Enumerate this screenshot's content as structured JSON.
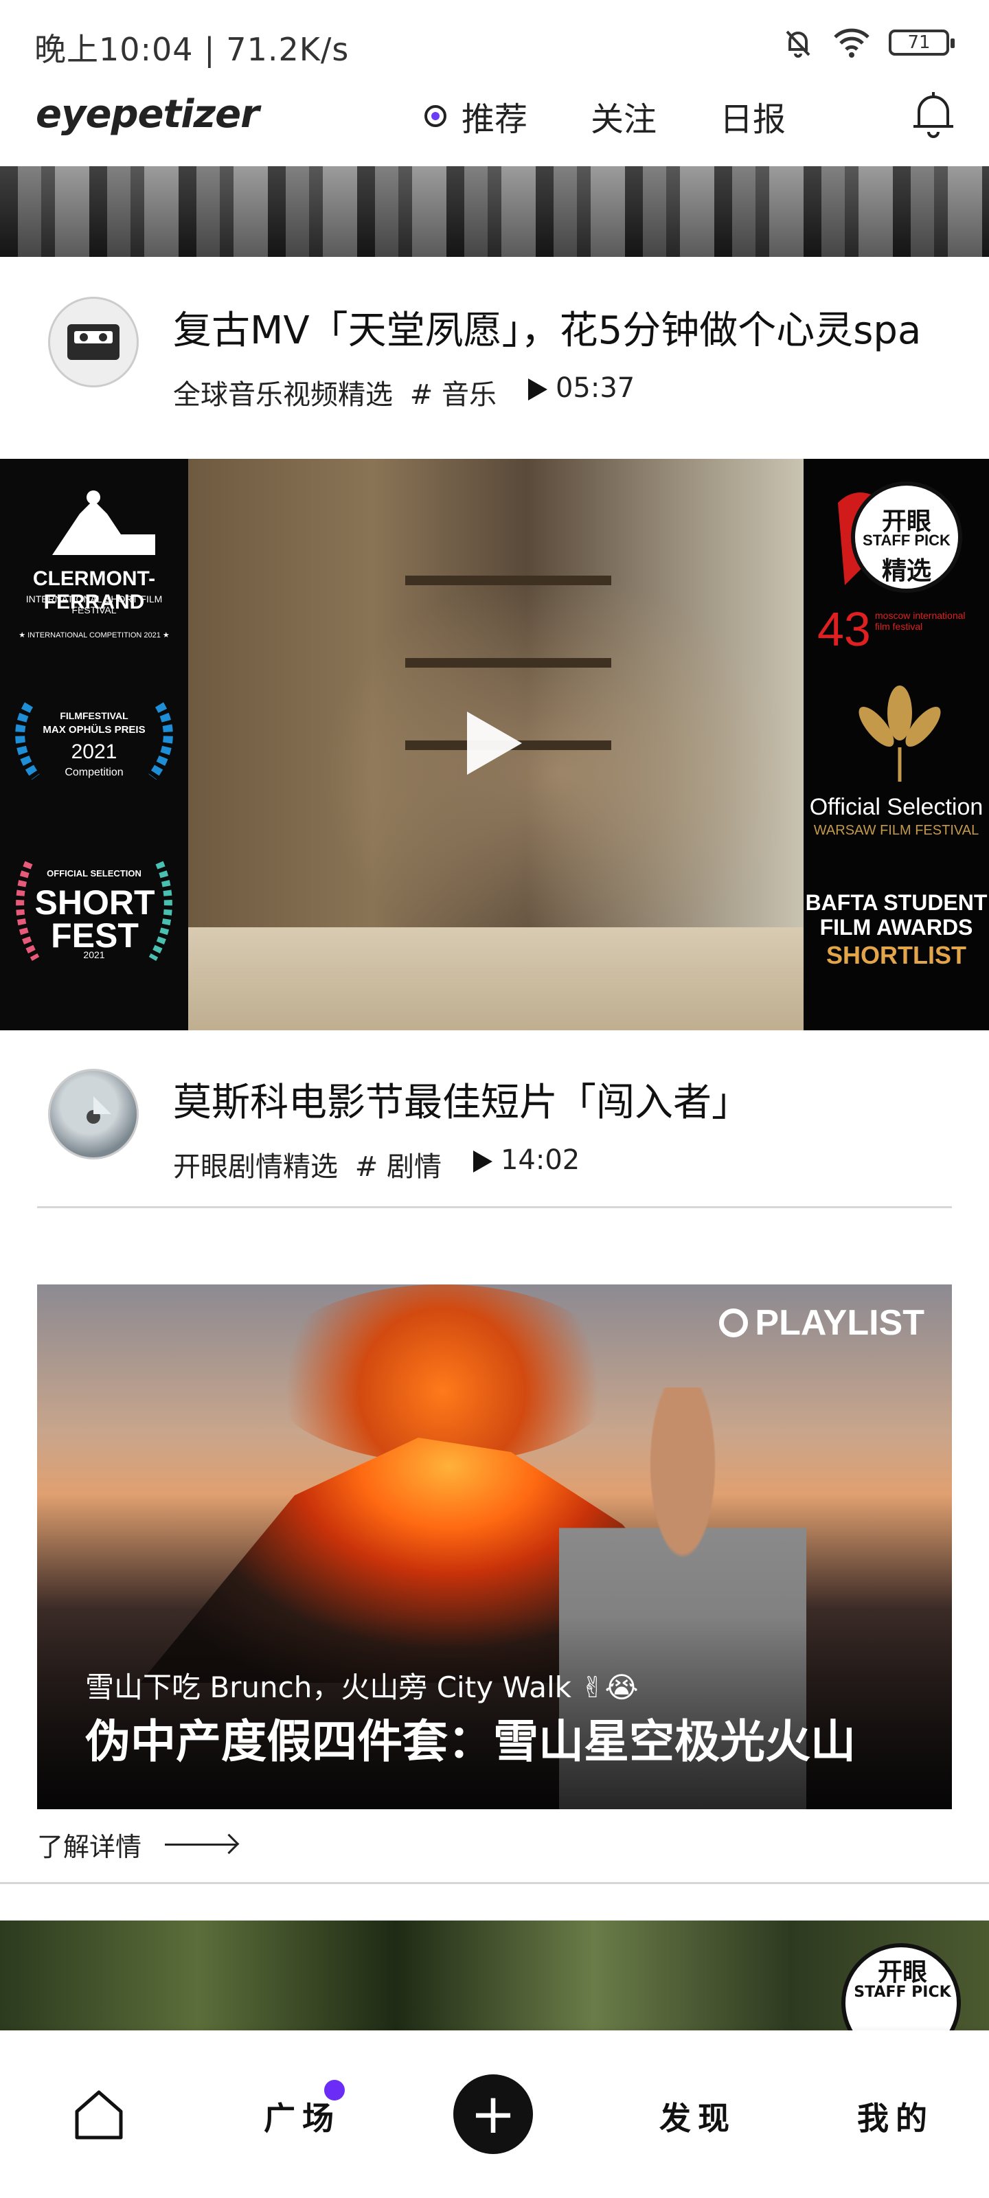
{
  "status_bar": {
    "time_speed": "晚上10:04 | 71.2K/s",
    "battery": "71"
  },
  "app": {
    "logo": "eyepetizer",
    "nav": [
      {
        "label": "推荐"
      },
      {
        "label": "关注"
      },
      {
        "label": "日报"
      }
    ]
  },
  "feed": {
    "item1": {
      "title": "复古MV「天堂夙愿」，花5分钟做个心灵spa",
      "category": "全球音乐视频精选",
      "tag": "# 音乐",
      "duration": "05:37"
    },
    "video_overlay": {
      "left_top": "CLERMONT-FERRAND",
      "left_top_sub": "INTERNATIONAL SHORT FILM FESTIVAL",
      "left_top_note": "★ INTERNATIONAL COMPETITION 2021 ★",
      "left_mid_title": "FILMFESTIVAL",
      "left_mid_sub": "MAX OPHÜLS PREIS",
      "left_mid_year": "2021",
      "left_mid_note": "Competition",
      "left_bottom_sub": "OFFICIAL SELECTION",
      "left_bottom_title": "SHORT FEST",
      "left_bottom_year": "2021",
      "right_badge_1": "开眼",
      "right_badge_2": "STAFF PICK",
      "right_badge_3": "精选",
      "right_fest_num": "43",
      "right_fest_text": "moscow international film festival",
      "right_mid_title": "Official Selection",
      "right_mid_sub": "WARSAW FILM FESTIVAL",
      "right_bottom_1": "BAFTA STUDENT",
      "right_bottom_2": "FILM AWARDS",
      "right_bottom_3": "SHORTLIST"
    },
    "item2": {
      "title": "莫斯科电影节最佳短片「闯入者」",
      "category": "开眼剧情精选",
      "tag": "# 剧情",
      "duration": "14:02"
    },
    "playlist": {
      "badge": "PLAYLIST",
      "subtitle": "雪山下吃 Brunch，火山旁 City Walk ✌😭",
      "title": "伪中产度假四件套：雪山星空极光火山",
      "more": "了解详情"
    },
    "next_badge_1": "开眼",
    "next_badge_2": "STAFF PICK"
  },
  "tabbar": {
    "square": "广场",
    "discover": "发现",
    "mine": "我的",
    "plus": "+"
  }
}
